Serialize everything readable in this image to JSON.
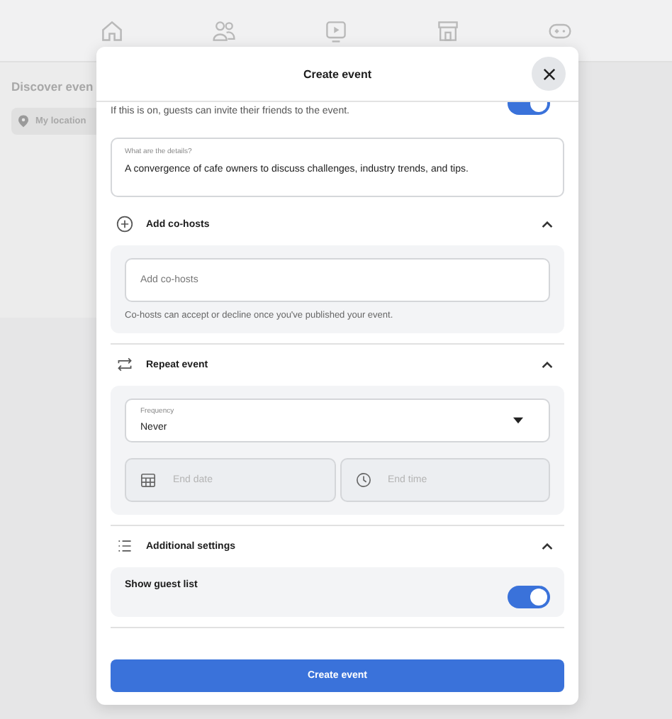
{
  "background": {
    "heading": "Discover even",
    "location_button": "My location"
  },
  "modal": {
    "title": "Create event"
  },
  "invite": {
    "description": "If this is on, guests can invite their friends to the event.",
    "on": true
  },
  "details": {
    "label": "What are the details?",
    "value": "A convergence of cafe owners to discuss challenges, industry trends, and tips."
  },
  "sections": [
    {
      "kind": "cohosts",
      "title": "Add co-hosts",
      "expanded": true,
      "placeholder": "Add co-hosts",
      "note": "Co-hosts can accept or decline once you've published your event."
    },
    {
      "kind": "repeat",
      "title": "Repeat event",
      "expanded": true,
      "frequency_label": "Frequency",
      "frequency": "Never",
      "end_date_placeholder": "End date",
      "end_time_placeholder": "End time",
      "ends_disabled": true
    },
    {
      "kind": "settings",
      "title": "Additional settings",
      "expanded": true,
      "settings": [
        {
          "label": "Show guest list",
          "on": true
        }
      ]
    }
  ],
  "submit": "Create event"
}
